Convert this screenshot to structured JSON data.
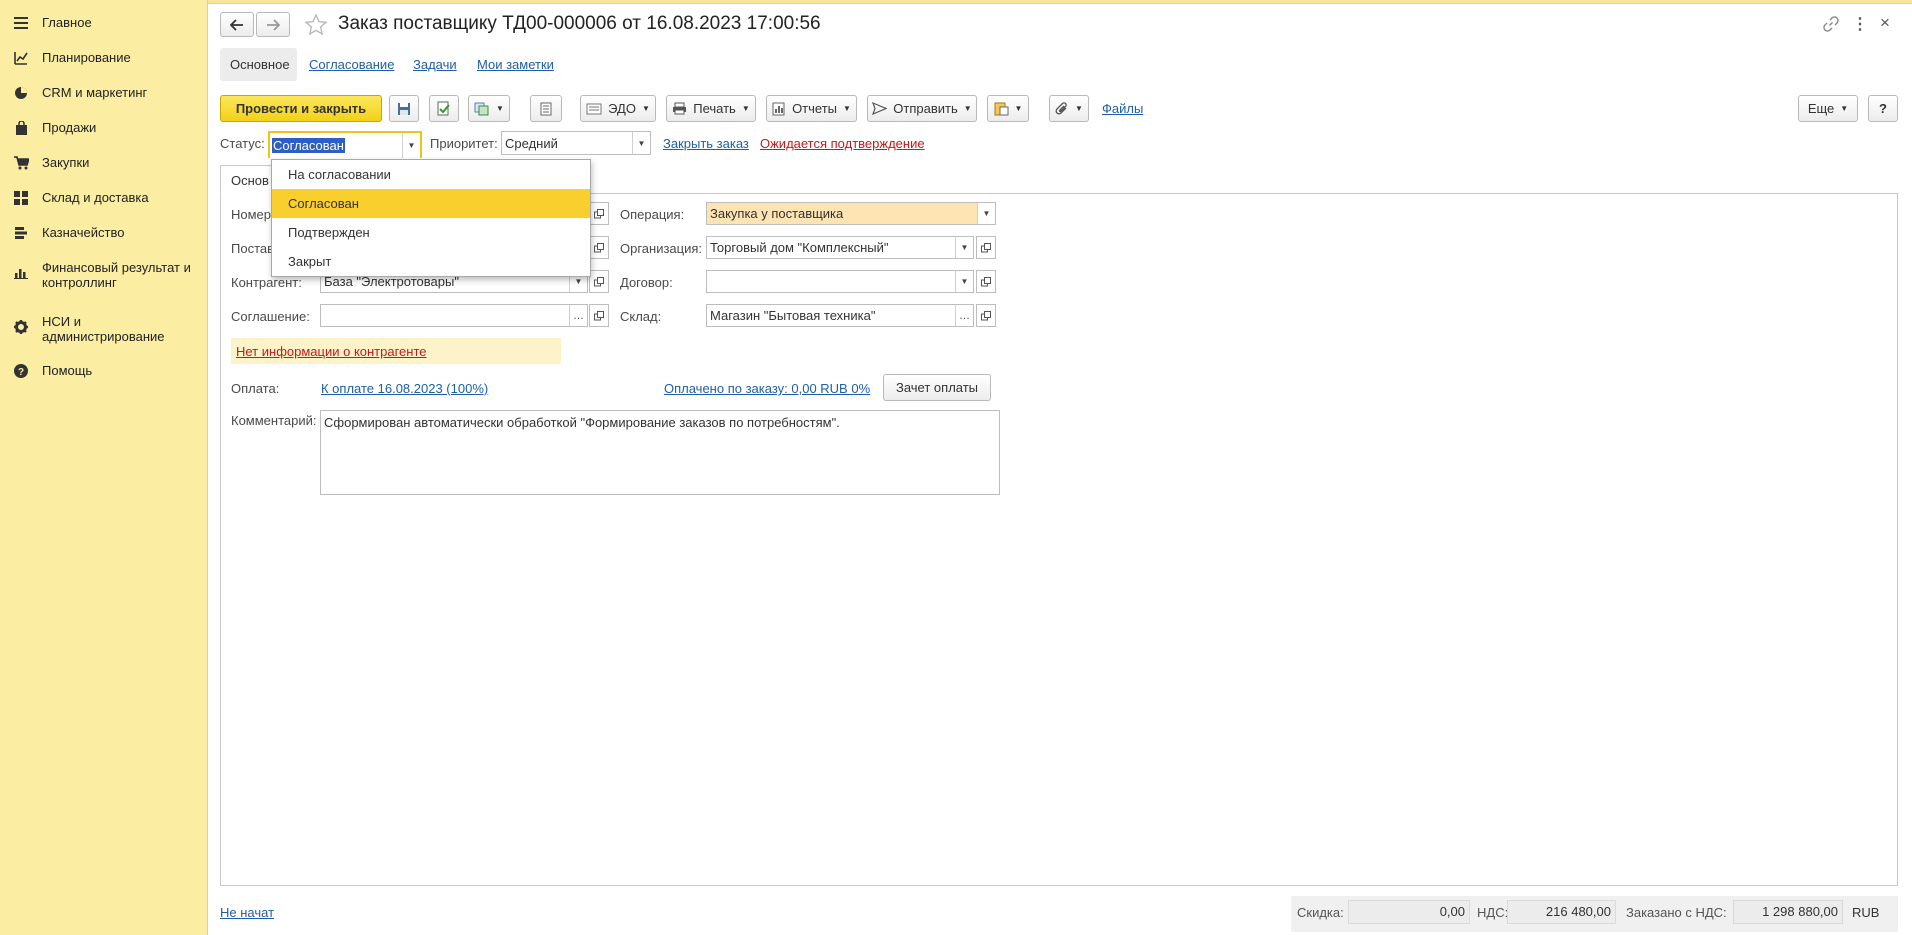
{
  "sidebar": {
    "items": [
      {
        "label": "Главное",
        "icon": "menu-icon"
      },
      {
        "label": "Планирование",
        "icon": "planning-icon"
      },
      {
        "label": "CRM и маркетинг",
        "icon": "pie-chart-icon"
      },
      {
        "label": "Продажи",
        "icon": "shopping-bag-icon"
      },
      {
        "label": "Закупки",
        "icon": "cart-icon"
      },
      {
        "label": "Склад и доставка",
        "icon": "grid-icon"
      },
      {
        "label": "Казначейство",
        "icon": "coins-icon"
      },
      {
        "label": "Финансовый результат и контроллинг",
        "icon": "bar-chart-icon"
      },
      {
        "label": "НСИ и администрирование",
        "icon": "gear-icon"
      },
      {
        "label": "Помощь",
        "icon": "help-icon"
      }
    ]
  },
  "header": {
    "title": "Заказ поставщику ТД00-000006 от 16.08.2023 17:00:56"
  },
  "tabs": {
    "main": "Основное",
    "approval": "Согласование",
    "tasks": "Задачи",
    "notes": "Мои заметки"
  },
  "toolbar": {
    "post_close": "Провести и закрыть",
    "edo": "ЭДО",
    "print": "Печать",
    "reports": "Отчеты",
    "send": "Отправить",
    "files": "Файлы",
    "more": "Еще",
    "help": "?"
  },
  "status_row": {
    "status_label": "Статус:",
    "status_value": "Согласован",
    "priority_label": "Приоритет:",
    "priority_value": "Средний",
    "close_order": "Закрыть заказ",
    "awaiting": "Ожидается подтверждение"
  },
  "status_dropdown": {
    "options": [
      "На согласовании",
      "Согласован",
      "Подтвержден",
      "Закрыт"
    ],
    "selected": "Согласован"
  },
  "form": {
    "inner_tab": "Основ",
    "number_label": "Номер",
    "supplier_label": "Постав",
    "counterparty_label": "Контрагент:",
    "counterparty_value": "База \"Электротовары\"",
    "agreement_label": "Соглашение:",
    "agreement_value": "",
    "operation_label": "Операция:",
    "operation_value": "Закупка у поставщика",
    "organization_label": "Организация:",
    "organization_value": "Торговый дом \"Комплексный\"",
    "contract_label": "Договор:",
    "contract_value": "",
    "warehouse_label": "Склад:",
    "warehouse_value": "Магазин \"Бытовая техника\"",
    "no_info": "Нет информации о контрагенте",
    "payment_label": "Оплата:",
    "payment_link": "К оплате 16.08.2023 (100%)",
    "paid_link": "Оплачено по заказу: 0,00 RUB 0%",
    "offset_button": "Зачет оплаты",
    "comment_label": "Комментарий:",
    "comment_value": "Сформирован автоматически обработкой \"Формирование заказов по потребностям\"."
  },
  "footer": {
    "state_link": "Не начат",
    "discount_label": "Скидка:",
    "discount_value": "0,00",
    "vat_label": "НДС:",
    "vat_value": "216 480,00",
    "ordered_label": "Заказано с НДС:",
    "ordered_value": "1 298 880,00",
    "currency": "RUB"
  },
  "colors": {
    "sidebar_bg": "#fbeda2",
    "primary_button": "#f3d117",
    "selected_option": "#f9cf2e",
    "link": "#1d5fa8",
    "warning_link": "#c3191b",
    "highlight_field": "#fde4b2"
  }
}
